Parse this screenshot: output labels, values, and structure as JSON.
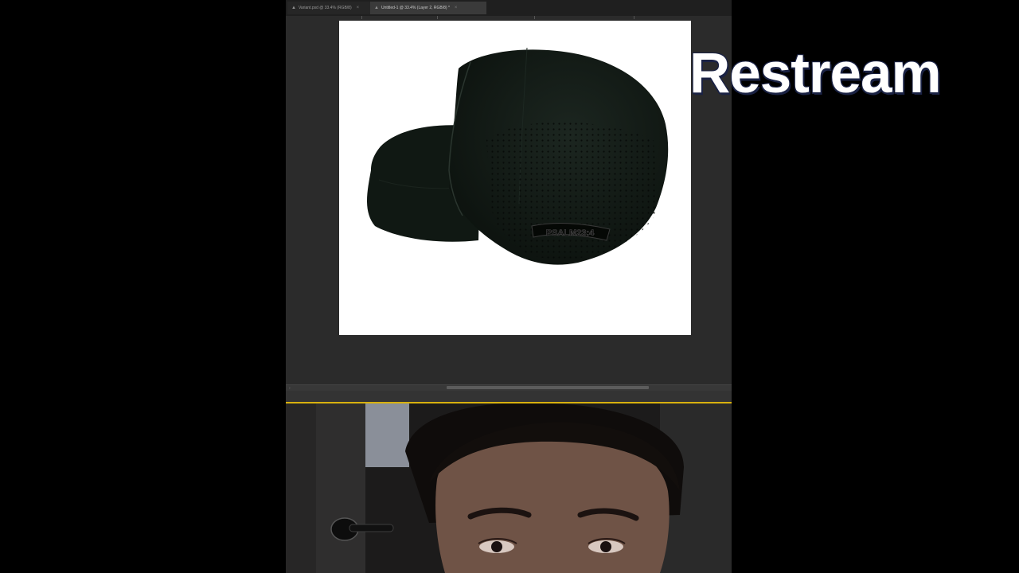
{
  "overlay": {
    "brand_text": "Restream"
  },
  "editor": {
    "tabs": [
      {
        "label": "Variant.psd @ 33.4% (RGB/8)",
        "active": false
      },
      {
        "label": "Untitled-1 @ 33.4% (Layer 2, RGB/8) *",
        "active": true
      }
    ],
    "status_text": "›",
    "colors": {
      "canvas_bg": "#ffffff",
      "workspace": "#2b2b2b",
      "hat": "#141c17"
    }
  },
  "canvas": {
    "hat_label": "PSALM23:4"
  },
  "webcam": {
    "border_color": "#d8b10e"
  }
}
